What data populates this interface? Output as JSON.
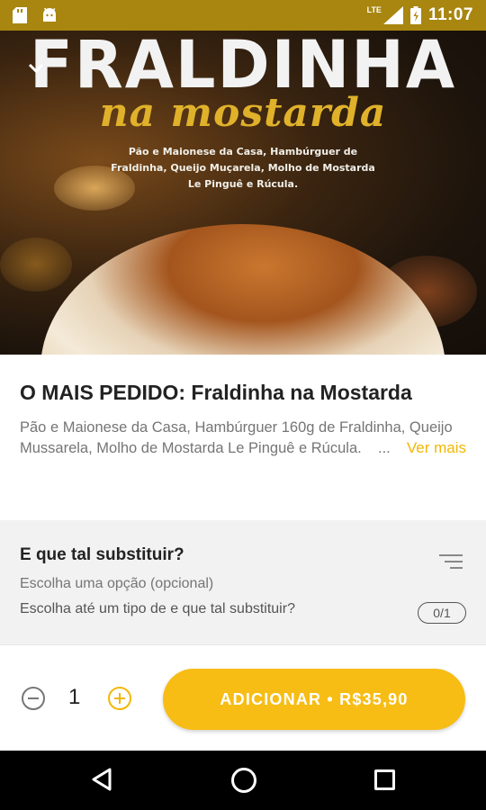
{
  "status_bar": {
    "time": "11:07",
    "network": "LTE",
    "icons": [
      "sd-card-icon",
      "android-icon",
      "signal-icon",
      "battery-icon"
    ]
  },
  "hero": {
    "title": "FRALDINHA",
    "subtitle": "na mostarda",
    "description": "Pão e Maionese da Casa, Hambúrguer de Fraldinha, Queijo Muçarela, Molho de Mostarda Le Pinguê e Rúcula."
  },
  "product": {
    "title": "O MAIS PEDIDO: Fraldinha na Mostarda",
    "description": "Pão e Maionese da Casa, Hambúrguer 160g de Fraldinha, Queijo Mussarela, Molho de Mostarda Le Pinguê e Rúcula.",
    "ellipsis": "...",
    "see_more": "Ver mais"
  },
  "option_group": {
    "title": "E que tal substituir?",
    "subtitle": "Escolha uma opção (opcional)",
    "instruction": "Escolha até um tipo de e que tal substituir?",
    "counter": "0/1"
  },
  "cart": {
    "quantity": "1",
    "add_label": "ADICIONAR • R$35,90"
  },
  "colors": {
    "status_bar": "#a8860f",
    "accent": "#f7bd14",
    "see_more": "#f2b705",
    "option_bg": "#f2f2f2"
  }
}
